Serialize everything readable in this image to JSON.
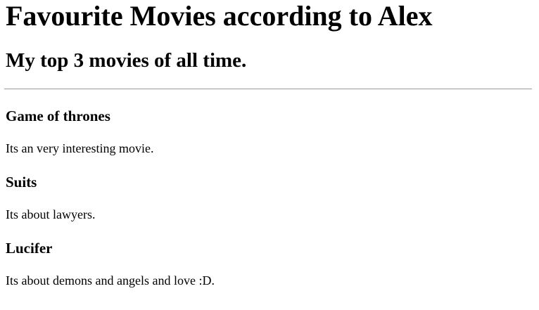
{
  "page": {
    "title": "Favourite Movies according to Alex",
    "subtitle": "My top 3 movies of all time."
  },
  "movies": [
    {
      "title": "Game of thrones",
      "description": "Its an very interesting movie."
    },
    {
      "title": "Suits",
      "description": "Its about lawyers."
    },
    {
      "title": "Lucifer",
      "description": "Its about demons and angels and love :D."
    }
  ]
}
